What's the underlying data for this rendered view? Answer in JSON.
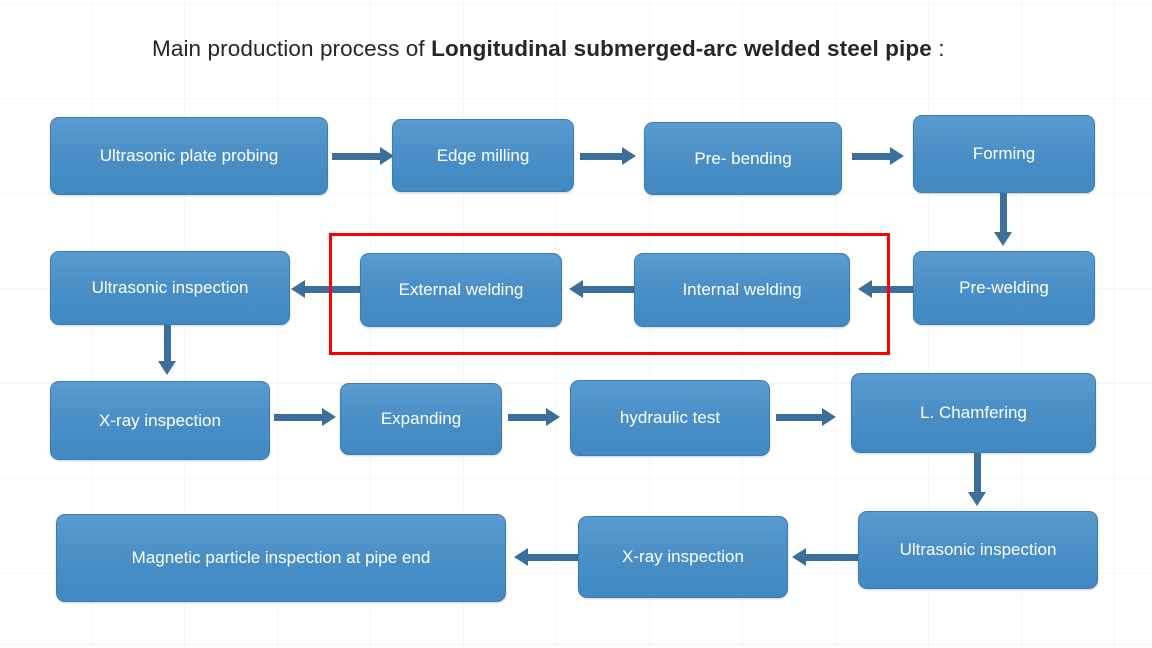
{
  "title": {
    "prefix": "Main production process of ",
    "strong": "Longitudinal submerged-arc welded steel pipe",
    "suffix": " :"
  },
  "colors": {
    "box_fill": "#4a8fc6",
    "box_border": "#3b7db4",
    "box_text": "#ffffff",
    "arrow": "#3c6f9c",
    "highlight_border": "#ff0000",
    "title_text": "#262626",
    "background": "#ffffff"
  },
  "nodes": [
    {
      "id": "ultrasonic-plate-probing",
      "label": "Ultrasonic plate probing"
    },
    {
      "id": "edge-milling",
      "label": "Edge milling"
    },
    {
      "id": "pre-bending",
      "label": "Pre- bending"
    },
    {
      "id": "forming",
      "label": "Forming"
    },
    {
      "id": "pre-welding",
      "label": "Pre-welding"
    },
    {
      "id": "internal-welding",
      "label": "Internal welding"
    },
    {
      "id": "external-welding",
      "label": "External welding"
    },
    {
      "id": "ultrasonic-inspection-1",
      "label": "Ultrasonic inspection"
    },
    {
      "id": "x-ray-inspection-1",
      "label": "X-ray inspection"
    },
    {
      "id": "expanding",
      "label": "Expanding"
    },
    {
      "id": "hydraulic-test",
      "label": "hydraulic test"
    },
    {
      "id": "l-chamfering",
      "label": "L. Chamfering"
    },
    {
      "id": "ultrasonic-inspection-2",
      "label": "Ultrasonic inspection"
    },
    {
      "id": "x-ray-inspection-2",
      "label": "X-ray inspection"
    },
    {
      "id": "magnetic-particle-inspection",
      "label": "Magnetic particle inspection at pipe end"
    }
  ],
  "flow_sequence": [
    "Ultrasonic plate probing",
    "Edge milling",
    "Pre- bending",
    "Forming",
    "Pre-welding",
    "Internal welding",
    "External welding",
    "Ultrasonic inspection",
    "X-ray inspection",
    "Expanding",
    "hydraulic test",
    "L. Chamfering",
    "Ultrasonic inspection",
    "X-ray inspection",
    "Magnetic particle inspection at pipe end"
  ],
  "highlight": {
    "encloses": [
      "External welding",
      "Internal welding"
    ]
  }
}
